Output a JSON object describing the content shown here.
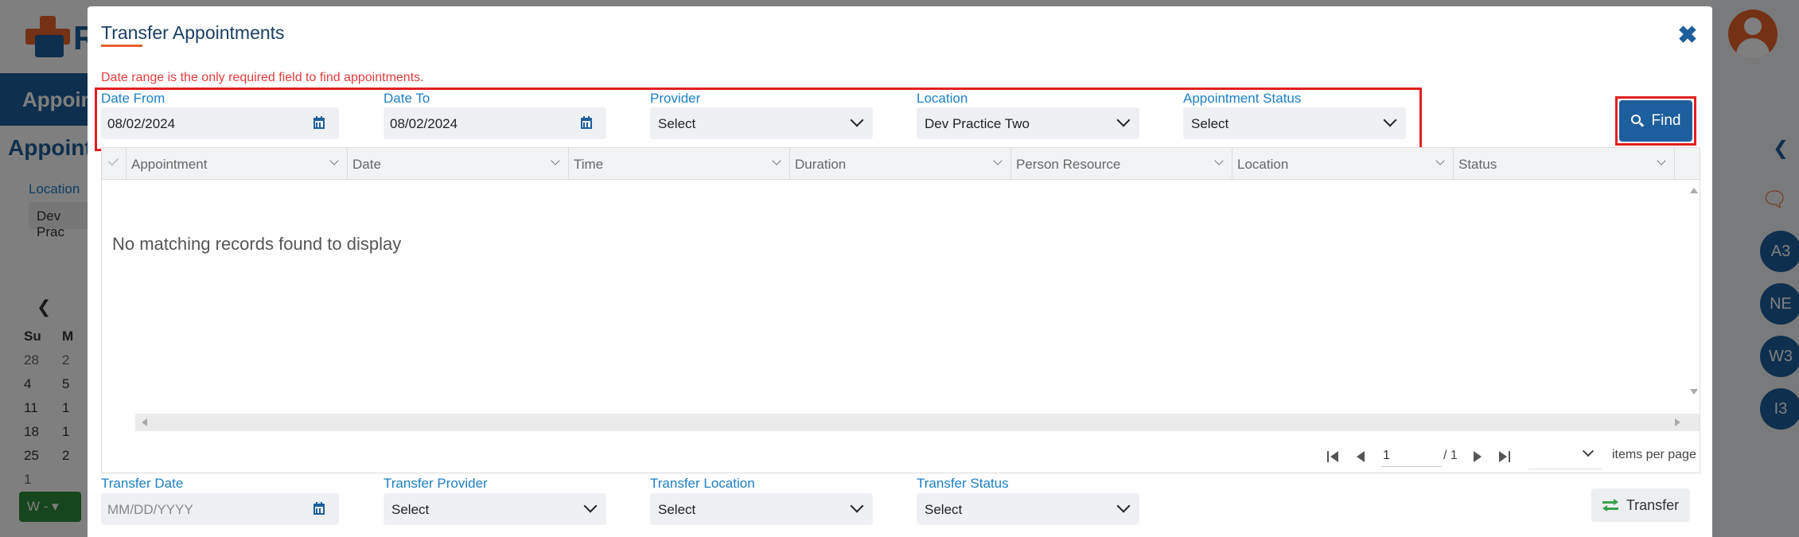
{
  "background": {
    "logo_letter": "R",
    "nav_title": "Appoin",
    "page_title": "Appoint",
    "location_label": "Location",
    "location_value": "Dev Prac",
    "calendar_header": [
      "Su",
      "M"
    ],
    "calendar_rows": [
      [
        "28",
        "2"
      ],
      [
        "4",
        "5"
      ],
      [
        "11",
        "1"
      ],
      [
        "18",
        "1"
      ],
      [
        "25",
        "2"
      ],
      [
        "1",
        ""
      ]
    ],
    "green_button_label": "W -",
    "right_rail_badges": [
      "A3",
      "NE",
      "W3",
      "I3"
    ]
  },
  "modal": {
    "title": "Transfer Appointments",
    "required_message": "Date range is the only required field to find appointments.",
    "filters": {
      "date_from": {
        "label": "Date From",
        "value": "08/02/2024"
      },
      "date_to": {
        "label": "Date To",
        "value": "08/02/2024"
      },
      "provider": {
        "label": "Provider",
        "value": "Select"
      },
      "location": {
        "label": "Location",
        "value": "Dev Practice Two"
      },
      "appointment_status": {
        "label": "Appointment Status",
        "value": "Select"
      }
    },
    "find_label": "Find",
    "grid": {
      "columns": [
        "Appointment",
        "Date",
        "Time",
        "Duration",
        "Person Resource",
        "Location",
        "Status"
      ],
      "empty_message": "No matching records found to display"
    },
    "pager": {
      "page": "1",
      "of_total": "/ 1",
      "items_per_page_label": "items per page"
    },
    "transfer": {
      "date": {
        "label": "Transfer Date",
        "placeholder": "MM/DD/YYYY"
      },
      "provider": {
        "label": "Transfer Provider",
        "value": "Select"
      },
      "location": {
        "label": "Transfer Location",
        "value": "Select"
      },
      "status": {
        "label": "Transfer Status",
        "value": "Select"
      }
    },
    "transfer_label": "Transfer"
  }
}
